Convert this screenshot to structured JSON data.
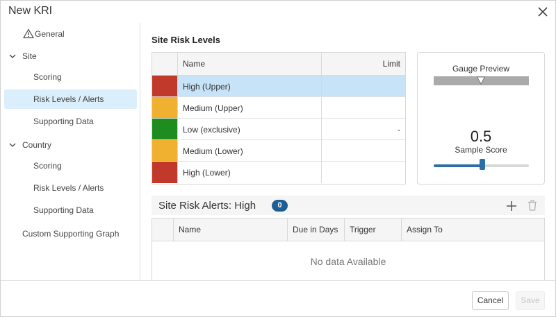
{
  "dialog": {
    "title": "New KRI",
    "close_icon": "close-icon"
  },
  "sidebar": {
    "general": "General",
    "site": "Site",
    "site_items": [
      "Scoring",
      "Risk Levels / Alerts",
      "Supporting Data"
    ],
    "country": "Country",
    "country_items": [
      "Scoring",
      "Risk Levels / Alerts",
      "Supporting Data"
    ],
    "custom": "Custom Supporting Graph",
    "active": "Site > Risk Levels / Alerts"
  },
  "levels": {
    "title": "Site Risk Levels",
    "columns": {
      "name": "Name",
      "limit": "Limit"
    },
    "rows": [
      {
        "name": "High (Upper)",
        "limit": "",
        "color": "#c0392b"
      },
      {
        "name": "Medium (Upper)",
        "limit": "",
        "color": "#f0b030"
      },
      {
        "name": "Low (exclusive)",
        "limit": "-",
        "color": "#1e8c1e"
      },
      {
        "name": "Medium (Lower)",
        "limit": "",
        "color": "#f0b030"
      },
      {
        "name": "High (Lower)",
        "limit": "",
        "color": "#c0392b"
      }
    ],
    "selected_row": 0,
    "selected_color": "#c6e3f7"
  },
  "gauge": {
    "title": "Gauge Preview",
    "value": "0.5",
    "sample_label": "Sample Score",
    "slider_fraction": 0.5,
    "accent": "#2d6da8"
  },
  "alerts": {
    "title": "Site Risk Alerts: High",
    "count": "0",
    "columns": [
      "Name",
      "Due in Days",
      "Trigger",
      "Assign To"
    ],
    "empty_text": "No data Available"
  },
  "footer": {
    "cancel": "Cancel",
    "save": "Save"
  }
}
